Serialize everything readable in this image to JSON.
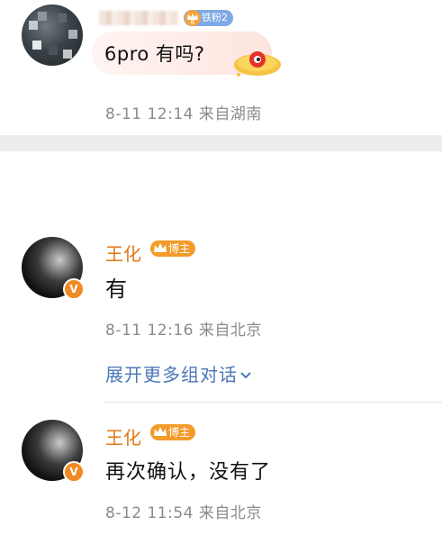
{
  "comment": {
    "fan_badge": "铁粉2",
    "text": "6pro 有吗?",
    "time": "8-11 12:14",
    "location": "来自湖南"
  },
  "reply1": {
    "username": "王化",
    "badge": "博主",
    "text": "有",
    "time": "8-11 12:16",
    "location": "来自北京",
    "expand_label": "展开更多组对话"
  },
  "reply2": {
    "username": "王化",
    "badge": "博主",
    "text": "再次确认，没有了",
    "time": "8-12 11:54",
    "location": "来自北京"
  },
  "colors": {
    "username": "#e07a14",
    "link": "#4d77b7",
    "meta": "#8a8a8a",
    "host_badge": "#f49b2a",
    "fan_badge": "#7fa9e6"
  }
}
